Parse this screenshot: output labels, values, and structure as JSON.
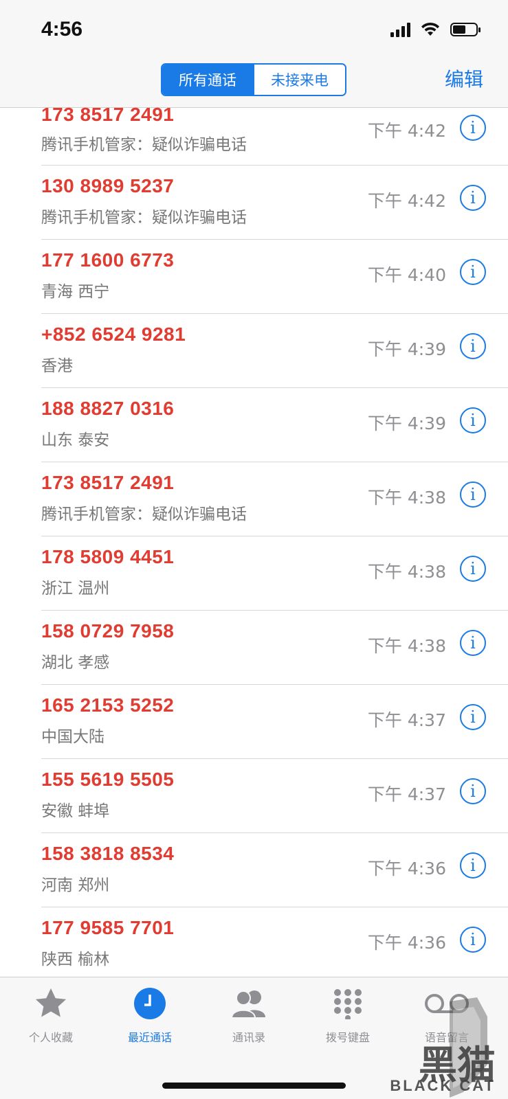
{
  "status_bar": {
    "time": "4:56",
    "battery_level": 0.55
  },
  "nav": {
    "segments": [
      {
        "label": "所有通话",
        "active": true
      },
      {
        "label": "未接来电",
        "active": false
      }
    ],
    "edit_label": "编辑"
  },
  "calls": [
    {
      "number": "173 8517 2491",
      "label": "腾讯手机管家：疑似诈骗电话",
      "time": "下午 4:42"
    },
    {
      "number": "130 8989 5237",
      "label": "腾讯手机管家：疑似诈骗电话",
      "time": "下午 4:42"
    },
    {
      "number": "177 1600 6773",
      "label": "青海 西宁",
      "time": "下午 4:40"
    },
    {
      "number": "+852 6524 9281",
      "label": "香港",
      "time": "下午 4:39"
    },
    {
      "number": "188 8827 0316",
      "label": "山东 泰安",
      "time": "下午 4:39"
    },
    {
      "number": "173 8517 2491",
      "label": "腾讯手机管家：疑似诈骗电话",
      "time": "下午 4:38"
    },
    {
      "number": "178 5809 4451",
      "label": "浙江 温州",
      "time": "下午 4:38"
    },
    {
      "number": "158 0729 7958",
      "label": "湖北 孝感",
      "time": "下午 4:38"
    },
    {
      "number": "165 2153 5252",
      "label": "中国大陆",
      "time": "下午 4:37"
    },
    {
      "number": "155 5619 5505",
      "label": "安徽 蚌埠",
      "time": "下午 4:37"
    },
    {
      "number": "158 3818 8534",
      "label": "河南 郑州",
      "time": "下午 4:36"
    },
    {
      "number": "177 9585 7701",
      "label": "陕西 榆林",
      "time": "下午 4:36"
    }
  ],
  "tabs": [
    {
      "label": "个人收藏",
      "icon": "star-icon",
      "active": false
    },
    {
      "label": "最近通话",
      "icon": "clock-icon",
      "active": true
    },
    {
      "label": "通讯录",
      "icon": "contacts-icon",
      "active": false
    },
    {
      "label": "拨号键盘",
      "icon": "keypad-icon",
      "active": false
    },
    {
      "label": "语音留言",
      "icon": "voicemail-icon",
      "active": false
    }
  ],
  "watermark": {
    "text": "黑猫",
    "subtext": "BLACK CAT"
  },
  "colors": {
    "accent": "#1a7ae6",
    "missed": "#e03c31"
  }
}
